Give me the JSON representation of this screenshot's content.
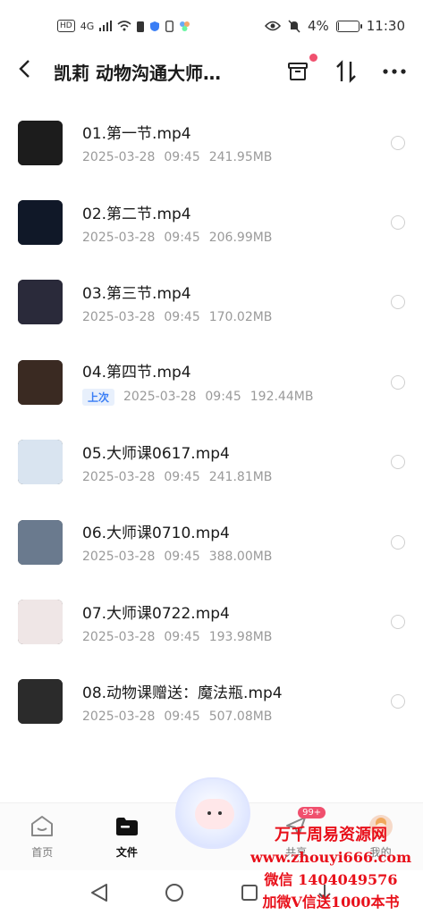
{
  "status_bar": {
    "left_badges": [
      "HD",
      "4G"
    ],
    "battery_percent": "4%",
    "time": "11:30"
  },
  "header": {
    "title": "凯莉 动物沟通大师…"
  },
  "files": [
    {
      "name": "01.第一节.mp4",
      "date": "2025-03-28",
      "time": "09:45",
      "size": "241.95MB",
      "tag": "",
      "thumb_color": "#1c1c1c"
    },
    {
      "name": "02.第二节.mp4",
      "date": "2025-03-28",
      "time": "09:45",
      "size": "206.99MB",
      "tag": "",
      "thumb_color": "#101828"
    },
    {
      "name": "03.第三节.mp4",
      "date": "2025-03-28",
      "time": "09:45",
      "size": "170.02MB",
      "tag": "",
      "thumb_color": "#2a2a3a"
    },
    {
      "name": "04.第四节.mp4",
      "date": "2025-03-28",
      "time": "09:45",
      "size": "192.44MB",
      "tag": "上次",
      "thumb_color": "#3a2a22"
    },
    {
      "name": "05.大师课0617.mp4",
      "date": "2025-03-28",
      "time": "09:45",
      "size": "241.81MB",
      "tag": "",
      "thumb_color": "#d9e4f0"
    },
    {
      "name": "06.大师课0710.mp4",
      "date": "2025-03-28",
      "time": "09:45",
      "size": "388.00MB",
      "tag": "",
      "thumb_color": "#6a7a8e"
    },
    {
      "name": "07.大师课0722.mp4",
      "date": "2025-03-28",
      "time": "09:45",
      "size": "193.98MB",
      "tag": "",
      "thumb_color": "#efe6e6"
    },
    {
      "name": "08.动物课赠送：魔法瓶.mp4",
      "date": "2025-03-28",
      "time": "09:45",
      "size": "507.08MB",
      "tag": "",
      "thumb_color": "#2b2b2b"
    }
  ],
  "bottom_nav": {
    "home": "首页",
    "files": "文件",
    "share": "共享",
    "share_badge": "99+",
    "mine": "我的"
  },
  "watermark": {
    "line1": "万千周易资源网",
    "line2": "www.zhouyi666.com",
    "line3": "微信 1404049576",
    "line4": "加微V信送1000本书"
  },
  "colors": {
    "accent": "#3a7ef5",
    "badge": "#f0506e",
    "watermark": "#e8101a"
  }
}
